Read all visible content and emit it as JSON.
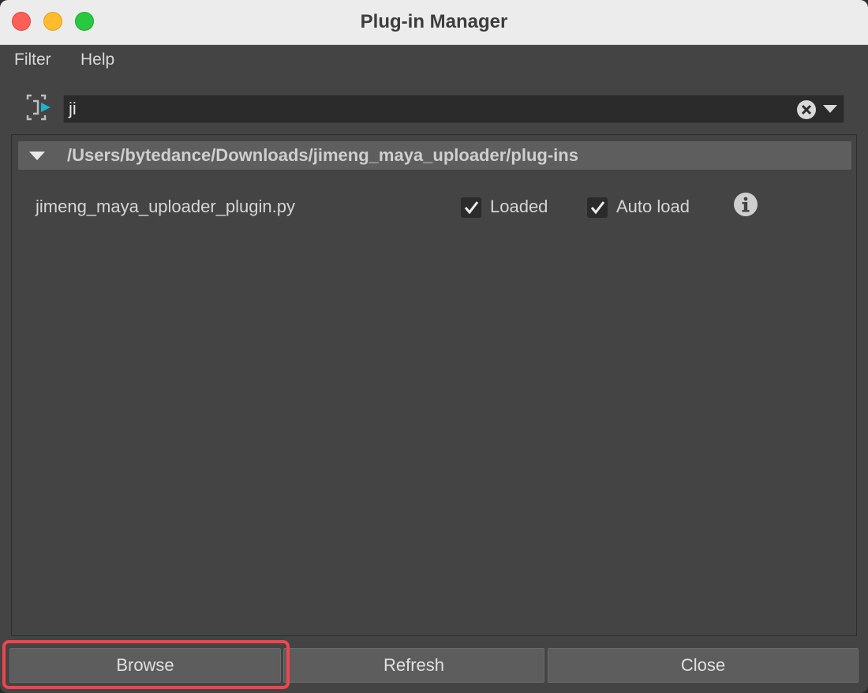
{
  "window": {
    "title": "Plug-in Manager"
  },
  "menubar": {
    "items": [
      "Filter",
      "Help"
    ]
  },
  "search": {
    "value": "ji"
  },
  "plugin_group": {
    "path": "/Users/bytedance/Downloads/jimeng_maya_uploader/plug-ins",
    "expanded": true,
    "plugins": [
      {
        "name": "jimeng_maya_uploader_plugin.py",
        "loaded_label": "Loaded",
        "loaded": true,
        "autoload_label": "Auto load",
        "autoload": true
      }
    ]
  },
  "buttons": {
    "browse": "Browse",
    "refresh": "Refresh",
    "close": "Close"
  },
  "colors": {
    "background": "#444444",
    "header_bar": "#5e5e5e",
    "highlight": "#f0454f",
    "accent_icon": "#1fb3c8"
  },
  "icons": [
    "filter-icon",
    "clear-icon",
    "dropdown-icon",
    "collapse-arrow-icon",
    "checkmark-icon",
    "info-icon"
  ]
}
